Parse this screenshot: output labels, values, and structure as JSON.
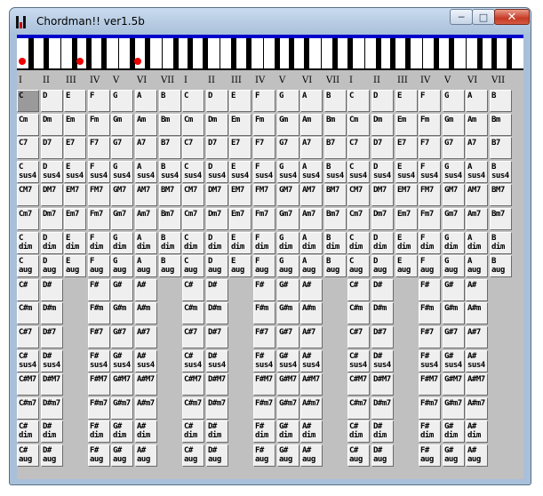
{
  "window": {
    "title": "Chordman!! ver1.5b",
    "min_glyph": "─",
    "max_glyph": "□",
    "close_glyph": "✕"
  },
  "degrees": [
    "I",
    "II",
    "III",
    "IV",
    "V",
    "VI",
    "VII"
  ],
  "natural_rows": [
    [
      "C",
      "D",
      "E",
      "F",
      "G",
      "A",
      "B"
    ],
    [
      "Cm",
      "Dm",
      "Em",
      "Fm",
      "Gm",
      "Am",
      "Bm"
    ],
    [
      "C7",
      "D7",
      "E7",
      "F7",
      "G7",
      "A7",
      "B7"
    ],
    [
      "C\nsus4",
      "D\nsus4",
      "E\nsus4",
      "F\nsus4",
      "G\nsus4",
      "A\nsus4",
      "B\nsus4"
    ],
    [
      "CM7",
      "DM7",
      "EM7",
      "FM7",
      "GM7",
      "AM7",
      "BM7"
    ],
    [
      "Cm7",
      "Dm7",
      "Em7",
      "Fm7",
      "Gm7",
      "Am7",
      "Bm7"
    ],
    [
      "C\ndim",
      "D\ndim",
      "E\ndim",
      "F\ndim",
      "G\ndim",
      "A\ndim",
      "B\ndim"
    ],
    [
      "C\naug",
      "D\naug",
      "E\naug",
      "F\naug",
      "G\naug",
      "A\naug",
      "B\naug"
    ]
  ],
  "sharp_rows": [
    [
      "C#",
      "D#",
      "",
      "F#",
      "G#",
      "A#",
      ""
    ],
    [
      "C#m",
      "D#m",
      "",
      "F#m",
      "G#m",
      "A#m",
      ""
    ],
    [
      "C#7",
      "D#7",
      "",
      "F#7",
      "G#7",
      "A#7",
      ""
    ],
    [
      "C#\nsus4",
      "D#\nsus4",
      "",
      "F#\nsus4",
      "G#\nsus4",
      "A#\nsus4",
      ""
    ],
    [
      "C#M7",
      "D#M7",
      "",
      "F#M7",
      "G#M7",
      "A#M7",
      ""
    ],
    [
      "C#m7",
      "D#m7",
      "",
      "F#m7",
      "G#m7",
      "A#m7",
      ""
    ],
    [
      "C#\ndim",
      "D#\ndim",
      "",
      "F#\ndim",
      "G#\ndim",
      "A#\ndim",
      ""
    ],
    [
      "C#\naug",
      "D#\naug",
      "",
      "F#\naug",
      "G#\naug",
      "A#\naug",
      ""
    ]
  ],
  "octaves": 3,
  "selected_chord": "C",
  "highlighted_keys": [
    "C",
    "E",
    "G"
  ],
  "colors": {
    "keyboard_top": "#0000cc",
    "key_dot": "#ee0000",
    "panel": "#c0c0c0",
    "button": "#efefef",
    "selected": "#9a9a9a"
  }
}
